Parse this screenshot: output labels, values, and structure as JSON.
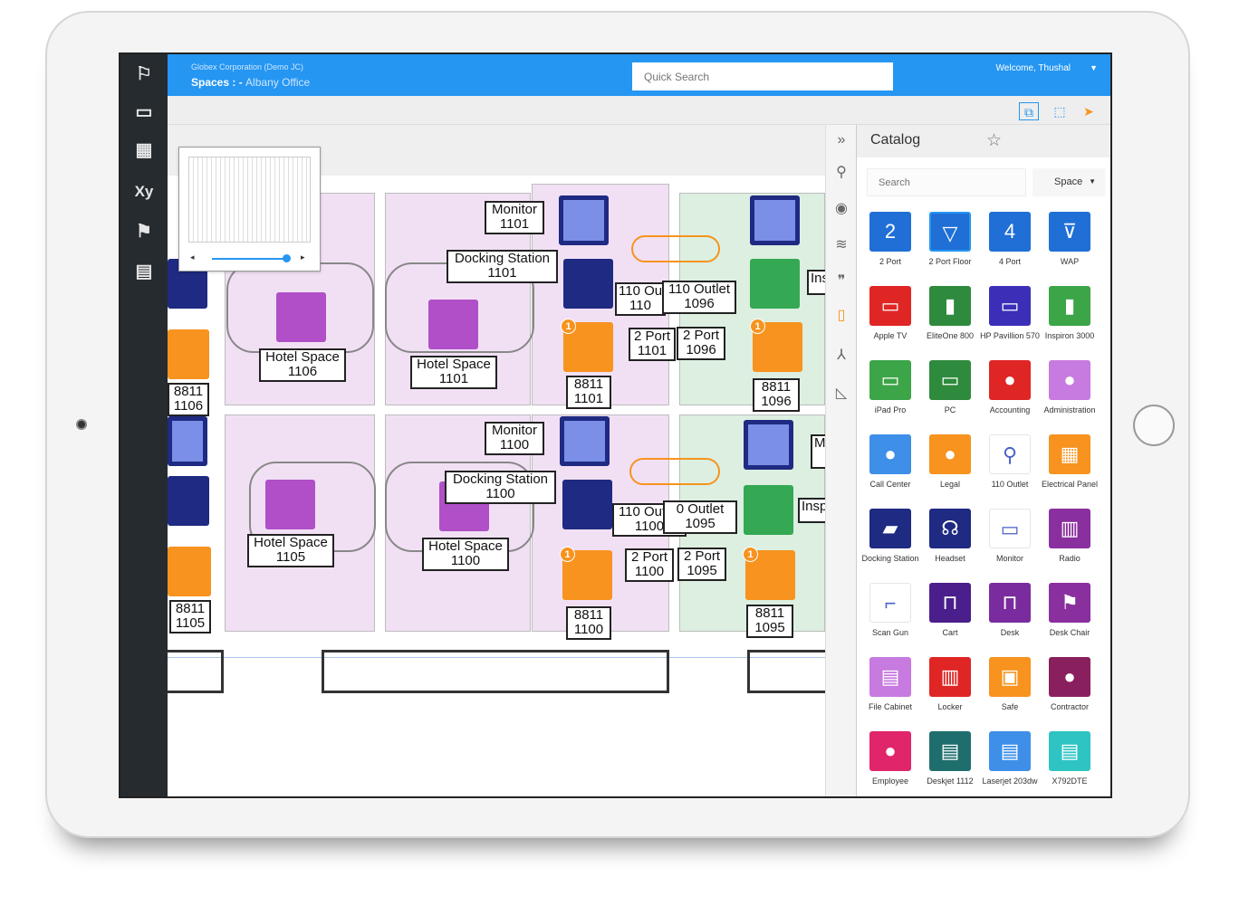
{
  "header": {
    "org": "Globex Corporation (Demo JC)",
    "spaces_label": "Spaces : -",
    "location": "Albany Office",
    "quick_search_placeholder": "Quick Search",
    "welcome": "Welcome, Thushal"
  },
  "catalog": {
    "title": "Catalog",
    "search_placeholder": "Search",
    "filter_value": "Space",
    "items": [
      {
        "name": "2 Port",
        "icon": "triangle-2-icon",
        "color": "#1f6fd6",
        "glyph": "2"
      },
      {
        "name": "2 Port Floor",
        "icon": "floor-box-icon",
        "color": "#1f6fd6",
        "glyph": "▽"
      },
      {
        "name": "4 Port",
        "icon": "triangle-4-icon",
        "color": "#1f6fd6",
        "glyph": "4"
      },
      {
        "name": "WAP",
        "icon": "wap-icon",
        "color": "#1f6fd6",
        "glyph": "⊽"
      },
      {
        "name": "Apple TV",
        "icon": "tv-icon",
        "color": "#e02525",
        "glyph": "▭"
      },
      {
        "name": "EliteOne 800",
        "icon": "tower-icon",
        "color": "#2e8a3c",
        "glyph": "▮"
      },
      {
        "name": "HP Pavillion 570",
        "icon": "pc-icon",
        "color": "#3b2fb8",
        "glyph": "▭"
      },
      {
        "name": "Inspiron 3000",
        "icon": "tower-icon",
        "color": "#3ca548",
        "glyph": "▮"
      },
      {
        "name": "iPad Pro",
        "icon": "tablet-icon",
        "color": "#3ca548",
        "glyph": "▭"
      },
      {
        "name": "PC",
        "icon": "pc-icon",
        "color": "#2e8a3c",
        "glyph": "▭"
      },
      {
        "name": "Accounting",
        "icon": "group-icon",
        "color": "#e02525",
        "glyph": "●"
      },
      {
        "name": "Administration",
        "icon": "group-icon",
        "color": "#c77adf",
        "glyph": "●"
      },
      {
        "name": "Call Center",
        "icon": "group-icon",
        "color": "#3d8fe8",
        "glyph": "●"
      },
      {
        "name": "Legal",
        "icon": "group-icon",
        "color": "#f7931e",
        "glyph": "●"
      },
      {
        "name": "110 Outlet",
        "icon": "outlet-icon",
        "color": "#ffffff",
        "glyph": "⚲"
      },
      {
        "name": "Electrical Panel",
        "icon": "panel-icon",
        "color": "#f7931e",
        "glyph": "▦"
      },
      {
        "name": "Docking Station",
        "icon": "dock-icon",
        "color": "#1f2a82",
        "glyph": "▰"
      },
      {
        "name": "Headset",
        "icon": "headset-icon",
        "color": "#1f2a82",
        "glyph": "☊"
      },
      {
        "name": "Monitor",
        "icon": "monitor-icon",
        "color": "#ffffff",
        "glyph": "▭"
      },
      {
        "name": "Radio",
        "icon": "radio-icon",
        "color": "#8a2f9e",
        "glyph": "▥"
      },
      {
        "name": "Scan Gun",
        "icon": "scan-gun-icon",
        "color": "#ffffff",
        "glyph": "⌐"
      },
      {
        "name": "Cart",
        "icon": "cart-icon",
        "color": "#4a1f8c",
        "glyph": "⊓"
      },
      {
        "name": "Desk",
        "icon": "desk-icon",
        "color": "#7a2c9e",
        "glyph": "⊓"
      },
      {
        "name": "Desk Chair",
        "icon": "chair-icon",
        "color": "#8a2f9e",
        "glyph": "⚑"
      },
      {
        "name": "File Cabinet",
        "icon": "cabinet-icon",
        "color": "#c77adf",
        "glyph": "▤"
      },
      {
        "name": "Locker",
        "icon": "locker-icon",
        "color": "#e02525",
        "glyph": "▥"
      },
      {
        "name": "Safe",
        "icon": "safe-icon",
        "color": "#f7931e",
        "glyph": "▣"
      },
      {
        "name": "Contractor",
        "icon": "person-icon",
        "color": "#8a1f5e",
        "glyph": "●"
      },
      {
        "name": "Employee",
        "icon": "person-icon",
        "color": "#e0256a",
        "glyph": "●"
      },
      {
        "name": "Deskjet 1112",
        "icon": "printer-icon",
        "color": "#1f6e6e",
        "glyph": "▤"
      },
      {
        "name": "Laserjet 203dw",
        "icon": "printer-icon",
        "color": "#3d8fe8",
        "glyph": "▤"
      },
      {
        "name": "X792DTE",
        "icon": "printer-icon",
        "color": "#2fc4c4",
        "glyph": "▤"
      }
    ]
  },
  "floor": {
    "labels": {
      "monitor_1101": [
        "Monitor",
        "1101"
      ],
      "dock_1101": [
        "Docking Station",
        "1101"
      ],
      "hotel_1106": [
        "Hotel Space",
        "1106"
      ],
      "hotel_1101": [
        "Hotel Space",
        "1101"
      ],
      "phone_1106": [
        "8811",
        "1106"
      ],
      "outlet_110a": [
        "110 Ou",
        "110"
      ],
      "outlet_1096": [
        "110 Outlet",
        "1096"
      ],
      "port_1101": [
        "2 Port",
        "1101"
      ],
      "port_1096": [
        "2 Port",
        "1096"
      ],
      "phone_1101": [
        "8811",
        "1101"
      ],
      "phone_1096": [
        "8811",
        "1096"
      ],
      "ins_a": [
        "Ins",
        ""
      ],
      "monitor_1100": [
        "Monitor",
        "1100"
      ],
      "dock_1100": [
        "Docking Station",
        "1100"
      ],
      "hotel_1105": [
        "Hotel Space",
        "1105"
      ],
      "hotel_1100": [
        "Hotel Space",
        "1100"
      ],
      "outlet_1100": [
        "110 Outlet",
        "1100"
      ],
      "outlet_1095": [
        "0 Outlet",
        "1095"
      ],
      "port_1100": [
        "2 Port",
        "1100"
      ],
      "port_1095": [
        "2 Port",
        "1095"
      ],
      "phone_1100": [
        "8811",
        "1100"
      ],
      "phone_1095": [
        "8811",
        "1095"
      ],
      "phone_1105": [
        "8811",
        "1105"
      ],
      "insp_b": [
        "Insp",
        ""
      ],
      "m_cut": [
        "M",
        ""
      ]
    },
    "badge": "1"
  },
  "colors": {
    "header": "#2596f2",
    "sidebar": "#262b30",
    "room_purple": "#f1e0f4",
    "room_green": "#dcefe1"
  }
}
